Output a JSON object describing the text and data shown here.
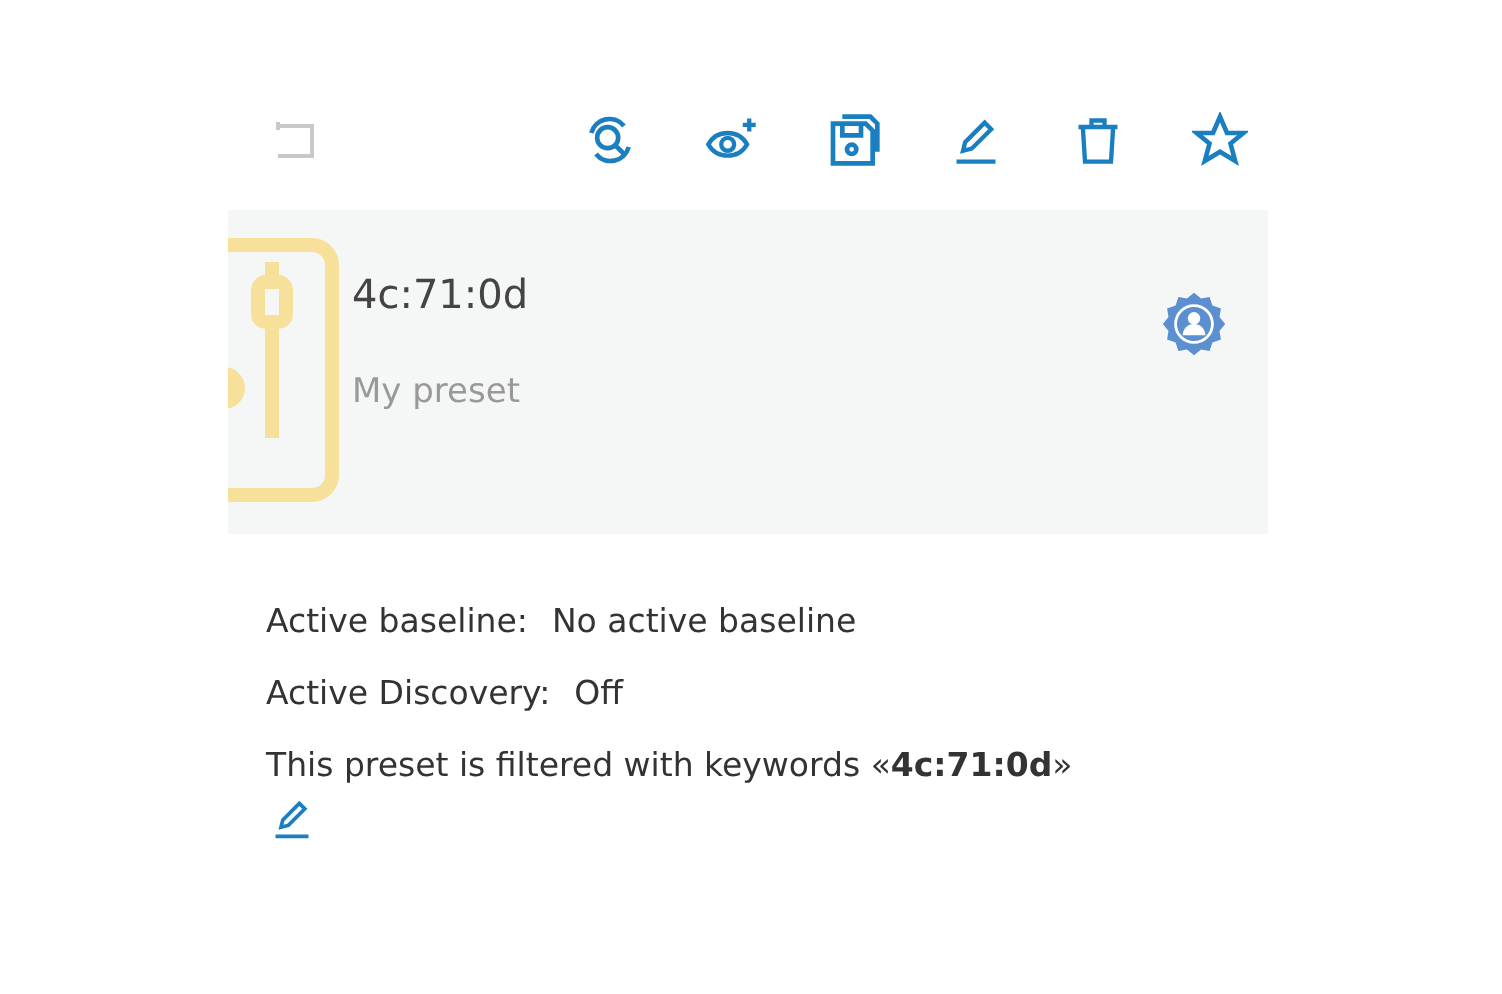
{
  "toolbar": [
    {
      "kind": "back",
      "disabled": true
    },
    {
      "kind": "rescan",
      "disabled": false
    },
    {
      "kind": "watch",
      "disabled": false
    },
    {
      "kind": "save",
      "disabled": false
    },
    {
      "kind": "edit",
      "disabled": false
    },
    {
      "kind": "delete",
      "disabled": false
    },
    {
      "kind": "favorite",
      "disabled": false
    }
  ],
  "preset": {
    "title": "4c:71:0d",
    "subtitle": "My preset"
  },
  "details": [
    {
      "label": "Active baseline:",
      "value": "No active baseline"
    },
    {
      "label": "Active Discovery:",
      "value": "Off"
    }
  ],
  "filter_note": "This preset is filtered with keywords «**4c:71:0d**»"
}
